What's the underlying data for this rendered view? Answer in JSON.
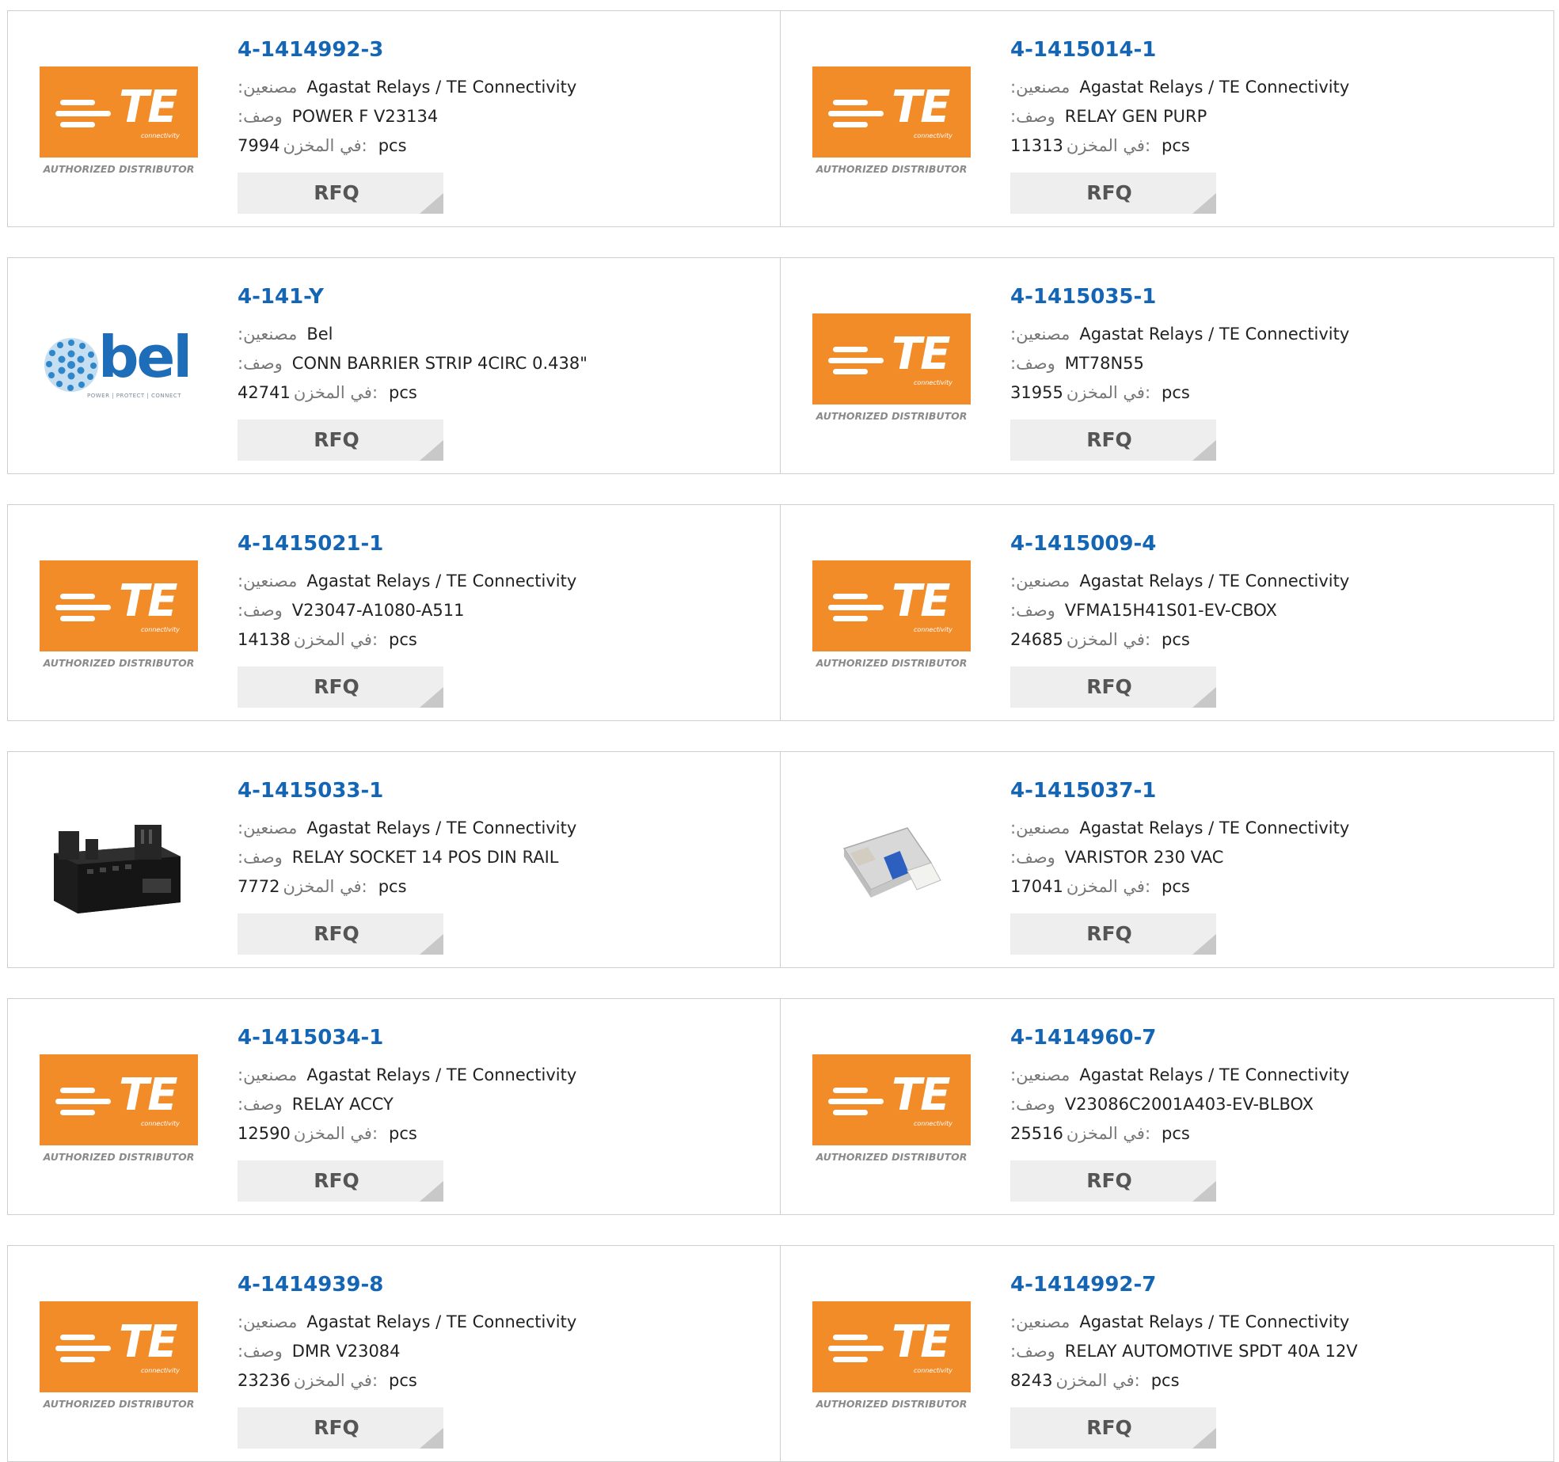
{
  "labels": {
    "manufacturer": ":مصنعين",
    "description": ":وصف",
    "in_stock": "في المخزن:",
    "unit": "pcs",
    "rfq": "RFQ"
  },
  "brand_logos": {
    "te": {
      "letters": "TE",
      "subtext": "connectivity",
      "caption": "AUTHORIZED DISTRIBUTOR",
      "color": "#f28c28"
    },
    "bel": {
      "word": "bel",
      "tagline": "POWER | PROTECT | CONNECT",
      "color": "#1d6db8"
    }
  },
  "colors": {
    "link": "#1565b5",
    "button_bg": "#eeeeee",
    "border": "#cfcfcf"
  },
  "products": [
    {
      "part": "4-1414992-3",
      "manufacturer": "Agastat Relays / TE Connectivity",
      "description": "POWER F V23134",
      "stock": "7994",
      "image": "te-logo"
    },
    {
      "part": "4-1415014-1",
      "manufacturer": "Agastat Relays / TE Connectivity",
      "description": "RELAY GEN PURP",
      "stock": "11313",
      "image": "te-logo"
    },
    {
      "part": "4-141-Y",
      "manufacturer": "Bel",
      "description": "CONN BARRIER STRIP 4CIRC 0.438\"",
      "stock": "42741",
      "image": "bel-logo"
    },
    {
      "part": "4-1415035-1",
      "manufacturer": "Agastat Relays / TE Connectivity",
      "description": "MT78N55",
      "stock": "31955",
      "image": "te-logo"
    },
    {
      "part": "4-1415021-1",
      "manufacturer": "Agastat Relays / TE Connectivity",
      "description": "V23047-A1080-A511",
      "stock": "14138",
      "image": "te-logo"
    },
    {
      "part": "4-1415009-4",
      "manufacturer": "Agastat Relays / TE Connectivity",
      "description": "VFMA15H41S01-EV-CBOX",
      "stock": "24685",
      "image": "te-logo"
    },
    {
      "part": "4-1415033-1",
      "manufacturer": "Agastat Relays / TE Connectivity",
      "description": "RELAY SOCKET 14 POS DIN RAIL",
      "stock": "7772",
      "image": "relay-socket-photo"
    },
    {
      "part": "4-1415037-1",
      "manufacturer": "Agastat Relays / TE Connectivity",
      "description": "VARISTOR 230 VAC",
      "stock": "17041",
      "image": "varistor-module-photo"
    },
    {
      "part": "4-1415034-1",
      "manufacturer": "Agastat Relays / TE Connectivity",
      "description": "RELAY ACCY",
      "stock": "12590",
      "image": "te-logo"
    },
    {
      "part": "4-1414960-7",
      "manufacturer": "Agastat Relays / TE Connectivity",
      "description": "V23086C2001A403-EV-BLBOX",
      "stock": "25516",
      "image": "te-logo"
    },
    {
      "part": "4-1414939-8",
      "manufacturer": "Agastat Relays / TE Connectivity",
      "description": "DMR V23084",
      "stock": "23236",
      "image": "te-logo"
    },
    {
      "part": "4-1414992-7",
      "manufacturer": "Agastat Relays / TE Connectivity",
      "description": "RELAY AUTOMOTIVE SPDT 40A 12V",
      "stock": "8243",
      "image": "te-logo"
    }
  ]
}
